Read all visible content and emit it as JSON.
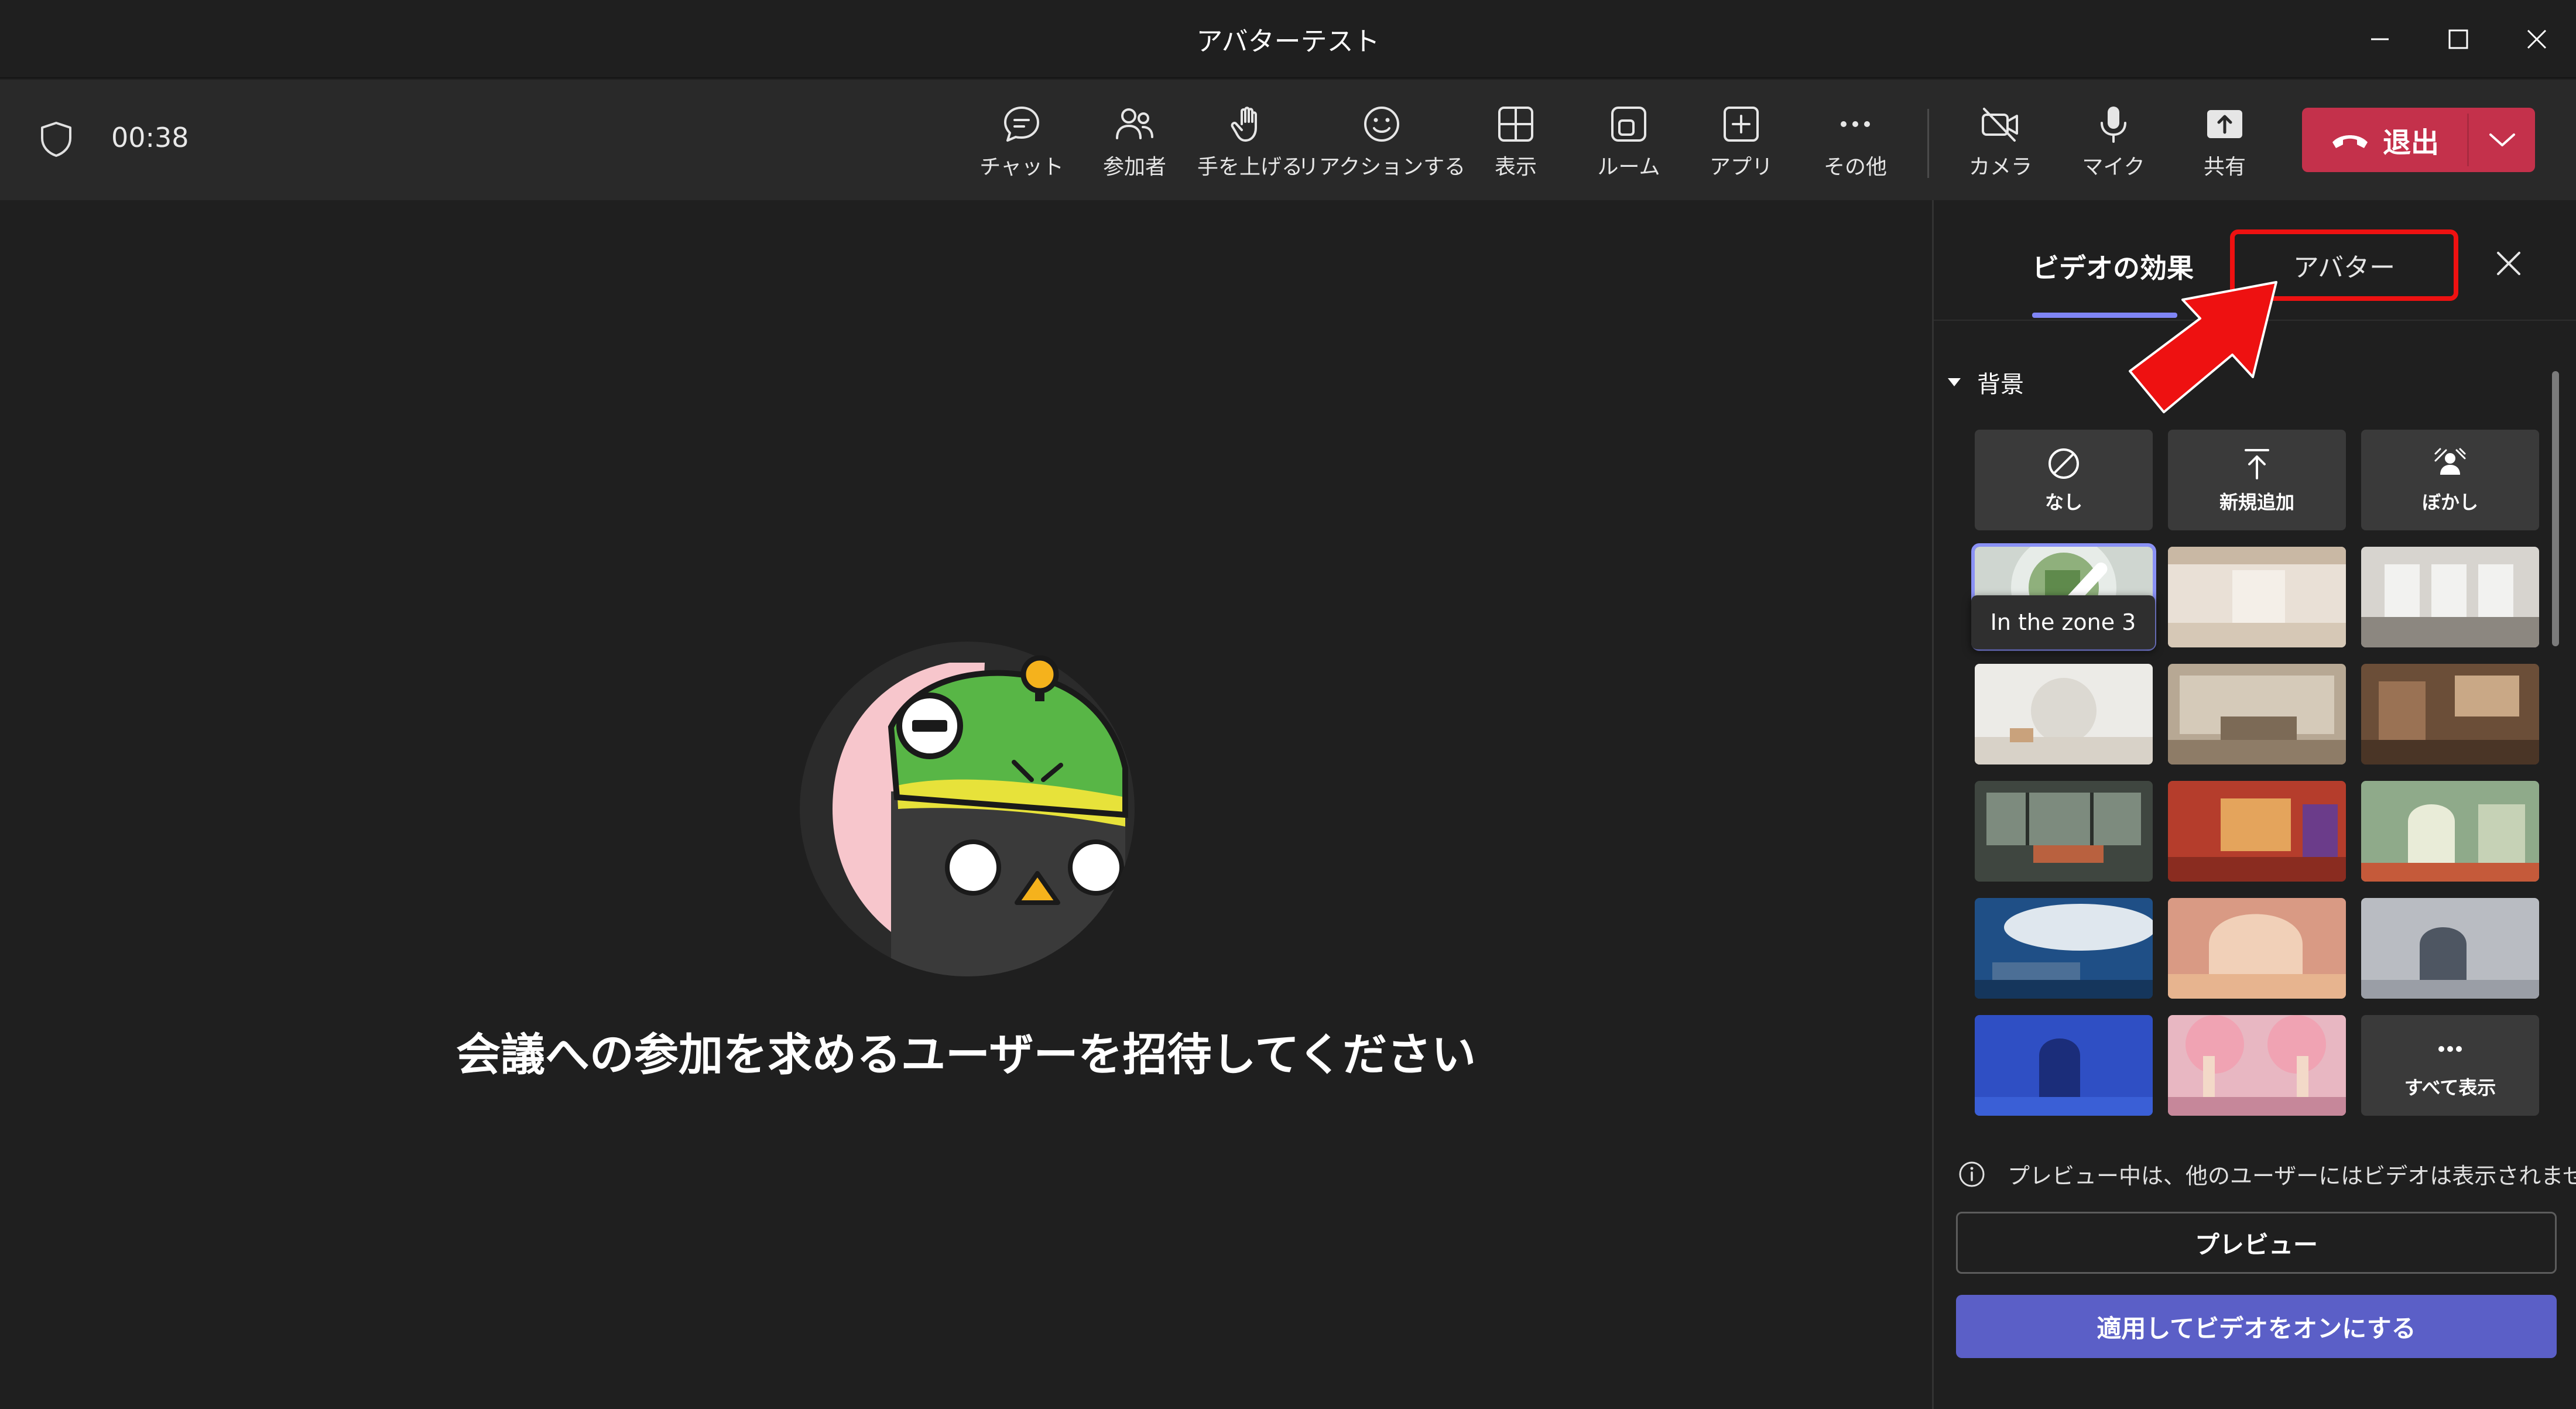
{
  "window": {
    "title": "アバターテスト"
  },
  "toolbar": {
    "timer": "00:38",
    "items": [
      {
        "label": "チャット",
        "icon": "chat-icon"
      },
      {
        "label": "参加者",
        "icon": "people-icon"
      },
      {
        "label": "手を上げる",
        "icon": "raise-hand-icon"
      },
      {
        "label": "リアクションする",
        "icon": "smiley-icon"
      },
      {
        "label": "表示",
        "icon": "grid-view-icon"
      },
      {
        "label": "ルーム",
        "icon": "rooms-icon"
      },
      {
        "label": "アプリ",
        "icon": "add-app-icon"
      },
      {
        "label": "その他",
        "icon": "more-icon"
      },
      {
        "label": "カメラ",
        "icon": "camera-off-icon"
      },
      {
        "label": "マイク",
        "icon": "mic-icon"
      },
      {
        "label": "共有",
        "icon": "share-icon"
      }
    ],
    "leave_label": "退出",
    "leave_color": "#c4314b"
  },
  "stage": {
    "invite_text": "会議への参加を求めるユーザーを招待してください"
  },
  "panel": {
    "tabs": [
      {
        "label": "ビデオの効果",
        "active": true
      },
      {
        "label": "アバター",
        "active": false
      }
    ],
    "section_title": "背景",
    "options": [
      {
        "label": "なし",
        "icon": "none-icon"
      },
      {
        "label": "新規追加",
        "icon": "upload-icon"
      },
      {
        "label": "ぼかし",
        "icon": "blur-icon"
      }
    ],
    "selected_tooltip": "In the zone 3",
    "show_all_label": "すべて表示",
    "info_text": "プレビュー中は、他のユーザーにはビデオは表示されません。",
    "preview_label": "プレビュー",
    "apply_label": "適用してビデオをオンにする",
    "accent_color": "#5b5fc7",
    "highlight_color": "#ee1111"
  }
}
